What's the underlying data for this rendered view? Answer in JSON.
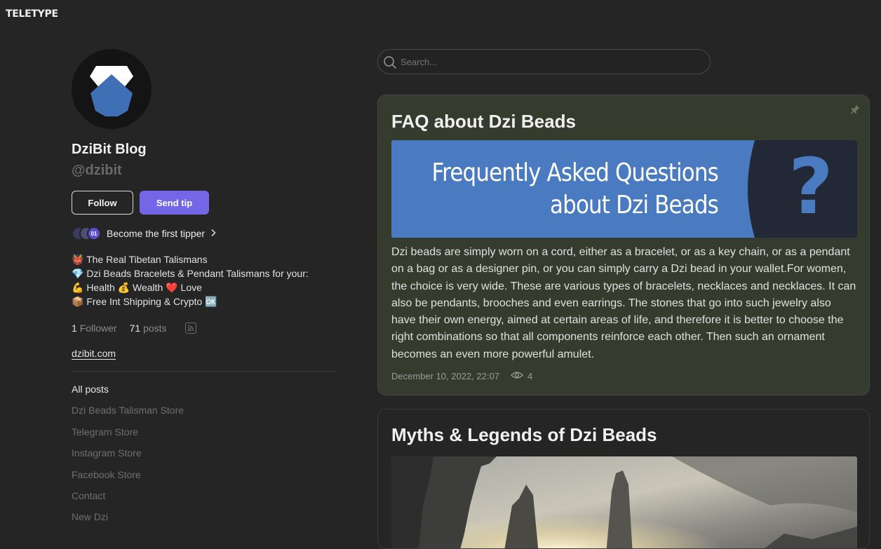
{
  "app": {
    "logo": "TELETYPE"
  },
  "profile": {
    "name": "DziBit Blog",
    "handle": "@dzibit",
    "follow_label": "Follow",
    "tip_label": "Send tip",
    "tippers_text": "Become the first tipper",
    "tippers_badge": "01",
    "bio_lines": [
      "👹 The Real Tibetan Talismans",
      "💎 Dzi Beads Bracelets & Pendant Talismans for your:",
      "💪 Health 💰 Wealth ❤️ Love",
      "📦 Free Int Shipping & Crypto 🆗"
    ],
    "followers_count": "1",
    "followers_label": "Follower",
    "posts_count": "71",
    "posts_label": "posts",
    "website": "dzibit.com"
  },
  "nav": {
    "items": [
      "All posts",
      "Dzi Beads Talisman Store",
      "Telegram Store",
      "Instagram Store",
      "Facebook Store",
      "Contact",
      "New Dzi"
    ],
    "active_index": 0
  },
  "search": {
    "placeholder": "Search..."
  },
  "posts": [
    {
      "title": "FAQ about Dzi Beads",
      "banner_line1": "Frequently Asked Questions",
      "banner_line2": "about Dzi Beads",
      "banner_glyph": "?",
      "excerpt": "Dzi beads are simply worn on a cord, either as a bracelet, or as a key chain, or as a pendant on a bag or as a designer pin, or you can simply carry a Dzi bead in your wallet.For women, the choice is very wide. These are various types of bracelets, necklaces and necklaces. It can also be pendants, brooches and even earrings. The stones that go into such jewelry also have their own energy, aimed at certain areas of life, and therefore it is better to choose the right combinations so that all components reinforce each other. Then such an ornament becomes an even more powerful amulet.",
      "date": "December 10, 2022, 22:07",
      "views": "4",
      "pinned": true
    },
    {
      "title": "Myths & Legends of Dzi Beads"
    }
  ],
  "colors": {
    "background": "#252525",
    "pinned_card": "#363c2d",
    "accent": "#7367e8",
    "banner_blue": "#4a7bc0"
  }
}
